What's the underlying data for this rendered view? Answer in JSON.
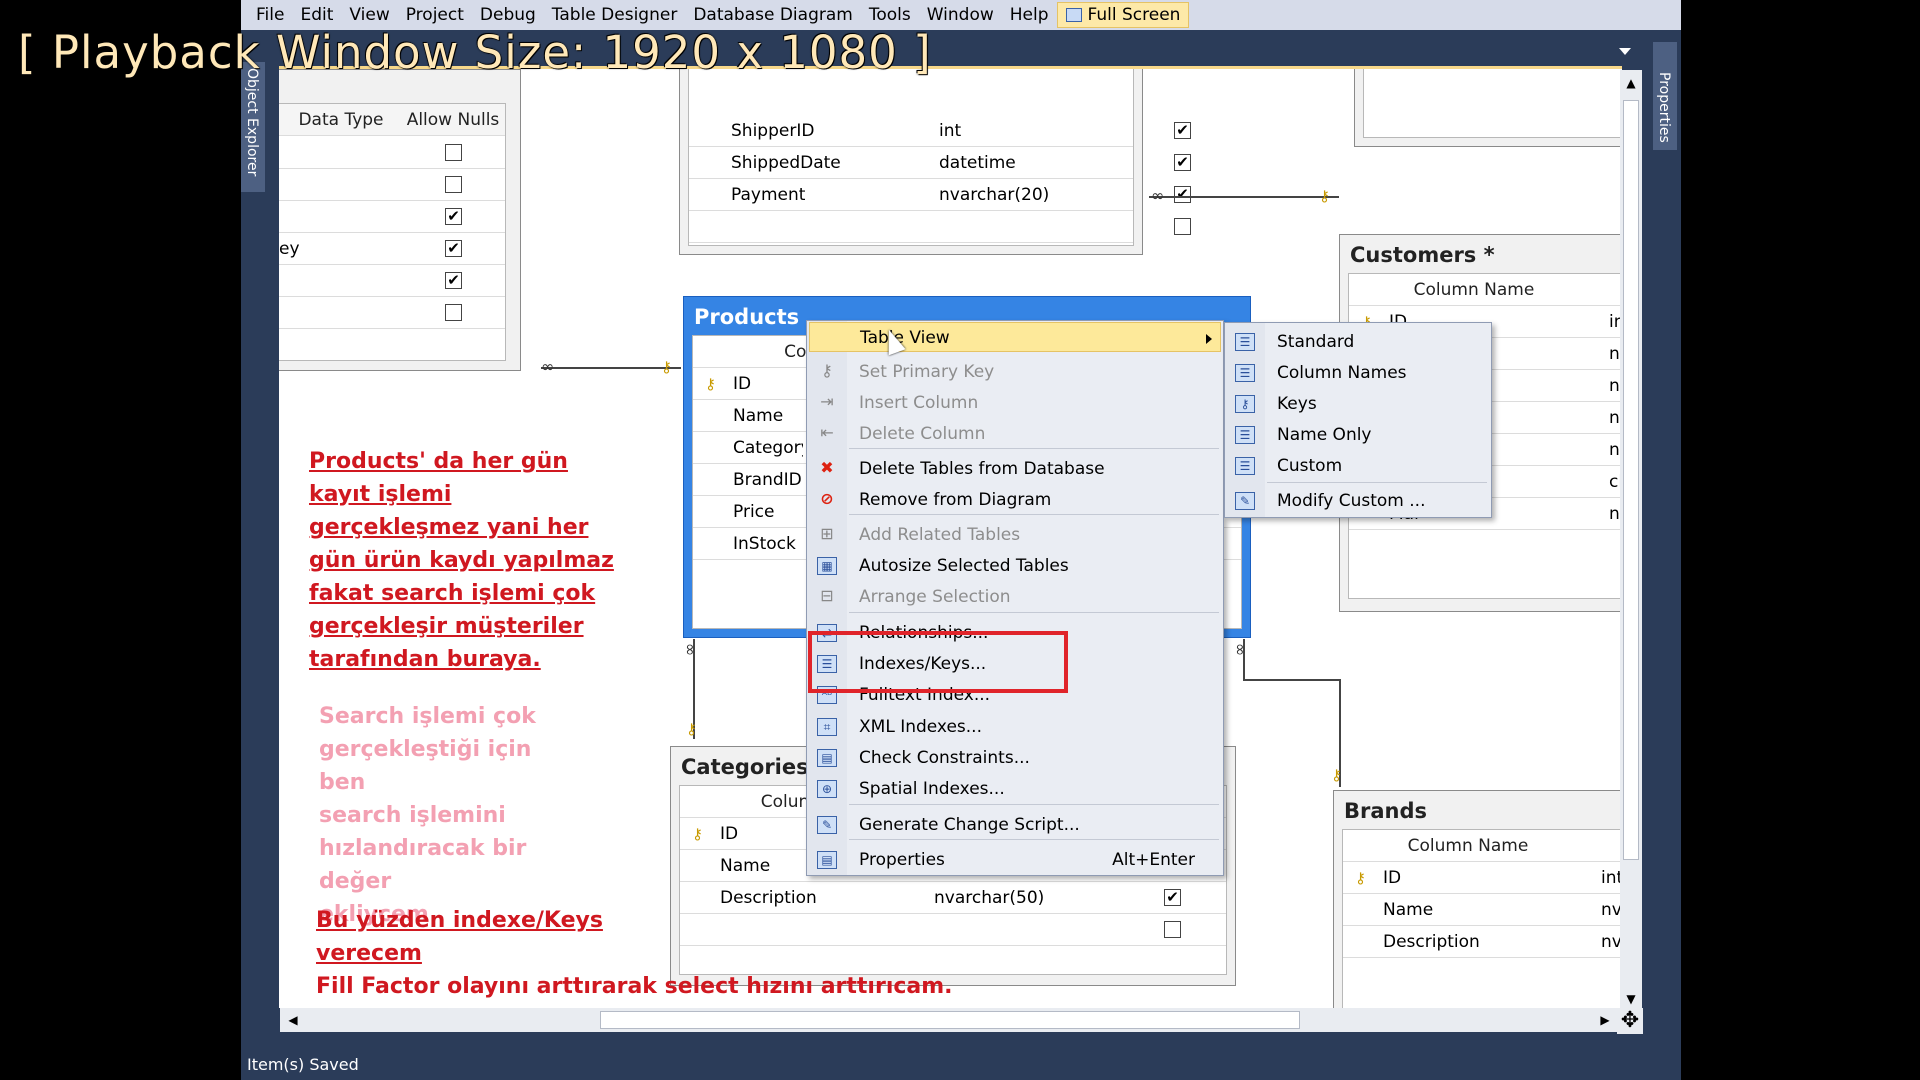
{
  "overlay": {
    "playback_label": "[ Playback Window Size: 1920 x 1080 ]"
  },
  "menubar": {
    "items": [
      "File",
      "Edit",
      "View",
      "Project",
      "Debug",
      "Table Designer",
      "Database Diagram",
      "Tools",
      "Window",
      "Help"
    ],
    "fullscreen_label": "Full Screen"
  },
  "side_tabs": {
    "left": "Object Explorer",
    "right": "Properties"
  },
  "status": {
    "text": "Item(s) Saved"
  },
  "tables": {
    "left_partial": {
      "headers": [
        "Data Type",
        "Allow Nulls"
      ],
      "rows": [
        {
          "type": "",
          "null": false
        },
        {
          "type": "",
          "null": false
        },
        {
          "type": "",
          "null": true
        },
        {
          "type": "ey",
          "null": true
        },
        {
          "type": "",
          "null": true
        },
        {
          "type": "",
          "null": false
        }
      ]
    },
    "orders_partial": {
      "rows": [
        {
          "name": "ShipperID",
          "type": "int",
          "null": true
        },
        {
          "name": "ShippedDate",
          "type": "datetime",
          "null": true
        },
        {
          "name": "Payment",
          "type": "nvarchar(20)",
          "null": true
        },
        {
          "name": "",
          "type": "",
          "null": false
        }
      ]
    },
    "products": {
      "title": "Products",
      "header": "Colu",
      "rows": [
        "ID",
        "Name",
        "CategoryI",
        "BrandID",
        "Price",
        "InStock"
      ]
    },
    "categories": {
      "title": "Categories",
      "header": "Colun",
      "rows": [
        {
          "name": "ID",
          "type": "",
          "null": false,
          "key": true
        },
        {
          "name": "Name",
          "type": "",
          "null": false,
          "key": false
        },
        {
          "name": "Description",
          "type": "nvarchar(50)",
          "null": true,
          "key": false
        },
        {
          "name": "",
          "type": "",
          "null": false,
          "key": false
        }
      ]
    },
    "customers": {
      "title": "Customers *",
      "header": "Column Name",
      "rows": [
        {
          "name": "ID",
          "type": "in"
        },
        {
          "name": "",
          "type": "n"
        },
        {
          "name": "",
          "type": "n"
        },
        {
          "name": "",
          "type": "n"
        },
        {
          "name": "",
          "type": "n"
        },
        {
          "name": "",
          "type": "cl"
        },
        {
          "name": "Mai",
          "type": "n"
        }
      ]
    },
    "brands": {
      "title": "Brands",
      "header": "Column Name",
      "rows": [
        {
          "name": "ID",
          "type": "int",
          "key": true
        },
        {
          "name": "Name",
          "type": "nv",
          "key": false
        },
        {
          "name": "Description",
          "type": "nv",
          "key": false
        }
      ]
    }
  },
  "notes": {
    "red_lines": [
      "Products' da her gün",
      "kayıt işlemi",
      "gerçekleşmez yani her",
      "gün ürün kaydı yapılmaz",
      "fakat search işlemi çok",
      "gerçekleşir müşteriler",
      "tarafından buraya."
    ],
    "pink_lines": [
      "Search işlemi çok",
      "gerçekleştiği için ben",
      "search işlemini",
      "hızlandıracak bir değer",
      "ekliycem"
    ],
    "red2_line1": "Bu yüzden indexe/Keys",
    "red2_line2": "verecem",
    "red2_line3": "Fill Factor olayını arttırarak select hızını arttırıcam."
  },
  "context_menu": {
    "items": [
      {
        "label": "Table View",
        "icon": "none",
        "disabled": false,
        "highlight": true,
        "submenu": true
      },
      {
        "label": "Set Primary Key",
        "icon": "key-icon",
        "disabled": true
      },
      {
        "label": "Insert Column",
        "icon": "insert-column-icon",
        "disabled": true
      },
      {
        "label": "Delete Column",
        "icon": "delete-column-icon",
        "disabled": true
      },
      {
        "label": "Delete Tables from Database",
        "icon": "delete-table-icon",
        "disabled": false
      },
      {
        "label": "Remove from Diagram",
        "icon": "remove-diagram-icon",
        "disabled": false
      },
      {
        "label": "Add Related Tables",
        "icon": "add-related-icon",
        "disabled": true
      },
      {
        "label": "Autosize Selected Tables",
        "icon": "autosize-icon",
        "disabled": false
      },
      {
        "label": "Arrange Selection",
        "icon": "arrange-icon",
        "disabled": true
      },
      {
        "label": "Relationships...",
        "icon": "relationship-icon",
        "disabled": false
      },
      {
        "label": "Indexes/Keys...",
        "icon": "indexes-icon",
        "disabled": false
      },
      {
        "label": "Fulltext Index...",
        "icon": "fulltext-icon",
        "disabled": false
      },
      {
        "label": "XML Indexes...",
        "icon": "xml-icon",
        "disabled": false
      },
      {
        "label": "Check Constraints...",
        "icon": "check-icon",
        "disabled": false
      },
      {
        "label": "Spatial Indexes...",
        "icon": "spatial-icon",
        "disabled": false
      },
      {
        "label": "Generate Change Script...",
        "icon": "script-icon",
        "disabled": false
      },
      {
        "label": "Properties",
        "icon": "properties-icon",
        "disabled": false,
        "shortcut": "Alt+Enter"
      }
    ]
  },
  "submenu": {
    "items": [
      "Standard",
      "Column Names",
      "Keys",
      "Name Only",
      "Custom",
      "Modify Custom ..."
    ]
  }
}
